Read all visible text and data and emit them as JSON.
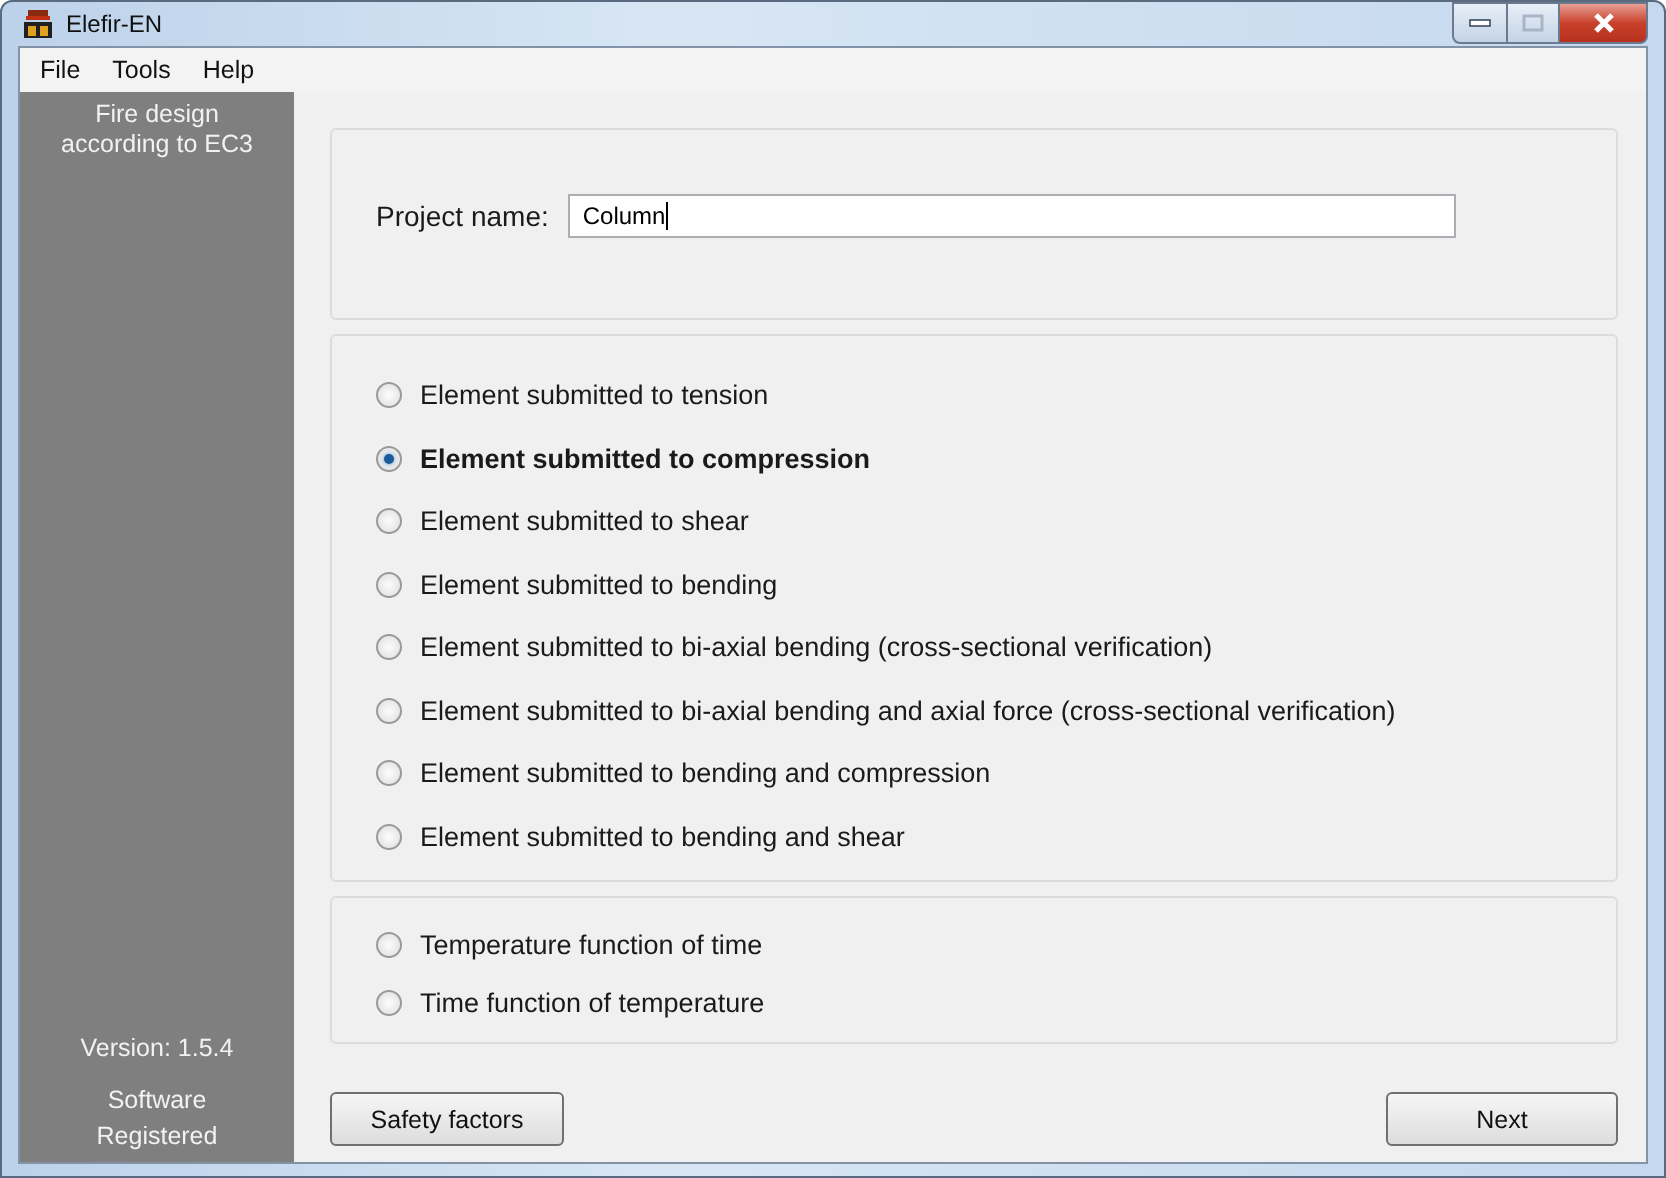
{
  "window": {
    "title": "Elefir-EN"
  },
  "menu": [
    "File",
    "Tools",
    "Help"
  ],
  "sidebar": {
    "heading": "Fire design according to EC3",
    "version": "Version: 1.5.4",
    "status": "Software Registered"
  },
  "project": {
    "label": "Project name:",
    "value": "Column"
  },
  "element_options": [
    {
      "label": "Element submitted to tension",
      "selected": false
    },
    {
      "label": "Element submitted to compression",
      "selected": true
    },
    {
      "label": "Element submitted to shear",
      "selected": false
    },
    {
      "label": "Element submitted to bending",
      "selected": false
    },
    {
      "label": "Element submitted to bi-axial bending (cross-sectional verification)",
      "selected": false
    },
    {
      "label": "Element submitted to bi-axial bending and axial force (cross-sectional verification)",
      "selected": false
    },
    {
      "label": "Element submitted to bending and compression",
      "selected": false
    },
    {
      "label": "Element submitted to bending and shear",
      "selected": false
    }
  ],
  "temperature_options": [
    {
      "label": "Temperature function of time",
      "selected": false
    },
    {
      "label": "Time function of temperature",
      "selected": false
    }
  ],
  "buttons": [
    "Safety factors",
    "Next"
  ]
}
